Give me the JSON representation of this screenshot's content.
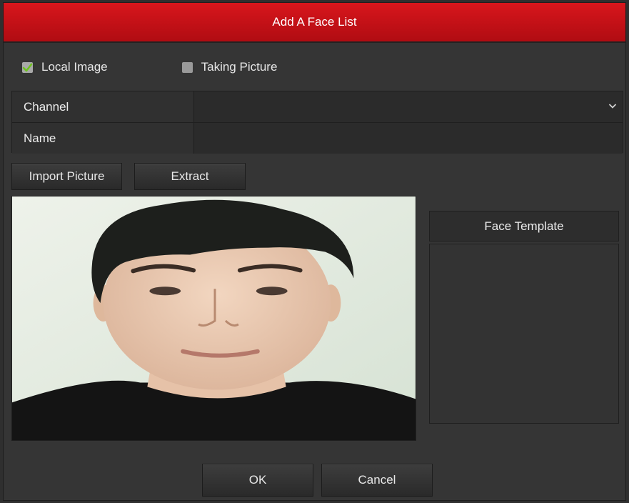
{
  "dialog": {
    "title": "Add A Face List"
  },
  "mode": {
    "local_image": {
      "label": "Local Image",
      "checked": true
    },
    "taking_picture": {
      "label": "Taking Picture",
      "checked": false
    }
  },
  "form": {
    "channel": {
      "label": "Channel",
      "value": ""
    },
    "name": {
      "label": "Name",
      "value": ""
    }
  },
  "actions": {
    "import_label": "Import Picture",
    "extract_label": "Extract"
  },
  "template": {
    "title": "Face Template"
  },
  "footer": {
    "ok_label": "OK",
    "cancel_label": "Cancel"
  },
  "colors": {
    "title_bar": "#c8101a",
    "check_mark": "#6ec21f"
  },
  "icons": {
    "checked": "check-icon",
    "dropdown": "chevron-down-icon"
  }
}
